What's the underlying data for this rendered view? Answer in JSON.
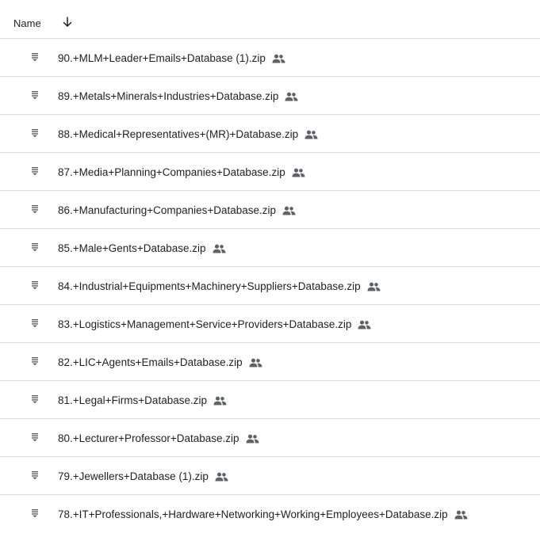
{
  "header": {
    "name_label": "Name",
    "sort_icon": "arrow-down-icon"
  },
  "icons": {
    "file": "zip-file-icon",
    "shared": "shared-people-icon"
  },
  "colors": {
    "text": "#1f1f1f",
    "icon": "#5f6368",
    "divider": "#dadce0"
  },
  "files": [
    {
      "name": "90.+MLM+Leader+Emails+Database (1).zip",
      "shared": true
    },
    {
      "name": "89.+Metals+Minerals+Industries+Database.zip",
      "shared": true
    },
    {
      "name": "88.+Medical+Representatives+(MR)+Database.zip",
      "shared": true
    },
    {
      "name": "87.+Media+Planning+Companies+Database.zip",
      "shared": true
    },
    {
      "name": "86.+Manufacturing+Companies+Database.zip",
      "shared": true
    },
    {
      "name": "85.+Male+Gents+Database.zip",
      "shared": true
    },
    {
      "name": "84.+Industrial+Equipments+Machinery+Suppliers+Database.zip",
      "shared": true
    },
    {
      "name": "83.+Logistics+Management+Service+Providers+Database.zip",
      "shared": true
    },
    {
      "name": "82.+LIC+Agents+Emails+Database.zip",
      "shared": true
    },
    {
      "name": "81.+Legal+Firms+Database.zip",
      "shared": true
    },
    {
      "name": "80.+Lecturer+Professor+Database.zip",
      "shared": true
    },
    {
      "name": "79.+Jewellers+Database (1).zip",
      "shared": true
    },
    {
      "name": "78.+IT+Professionals,+Hardware+Networking+Working+Employees+Database.zip",
      "shared": true
    }
  ]
}
